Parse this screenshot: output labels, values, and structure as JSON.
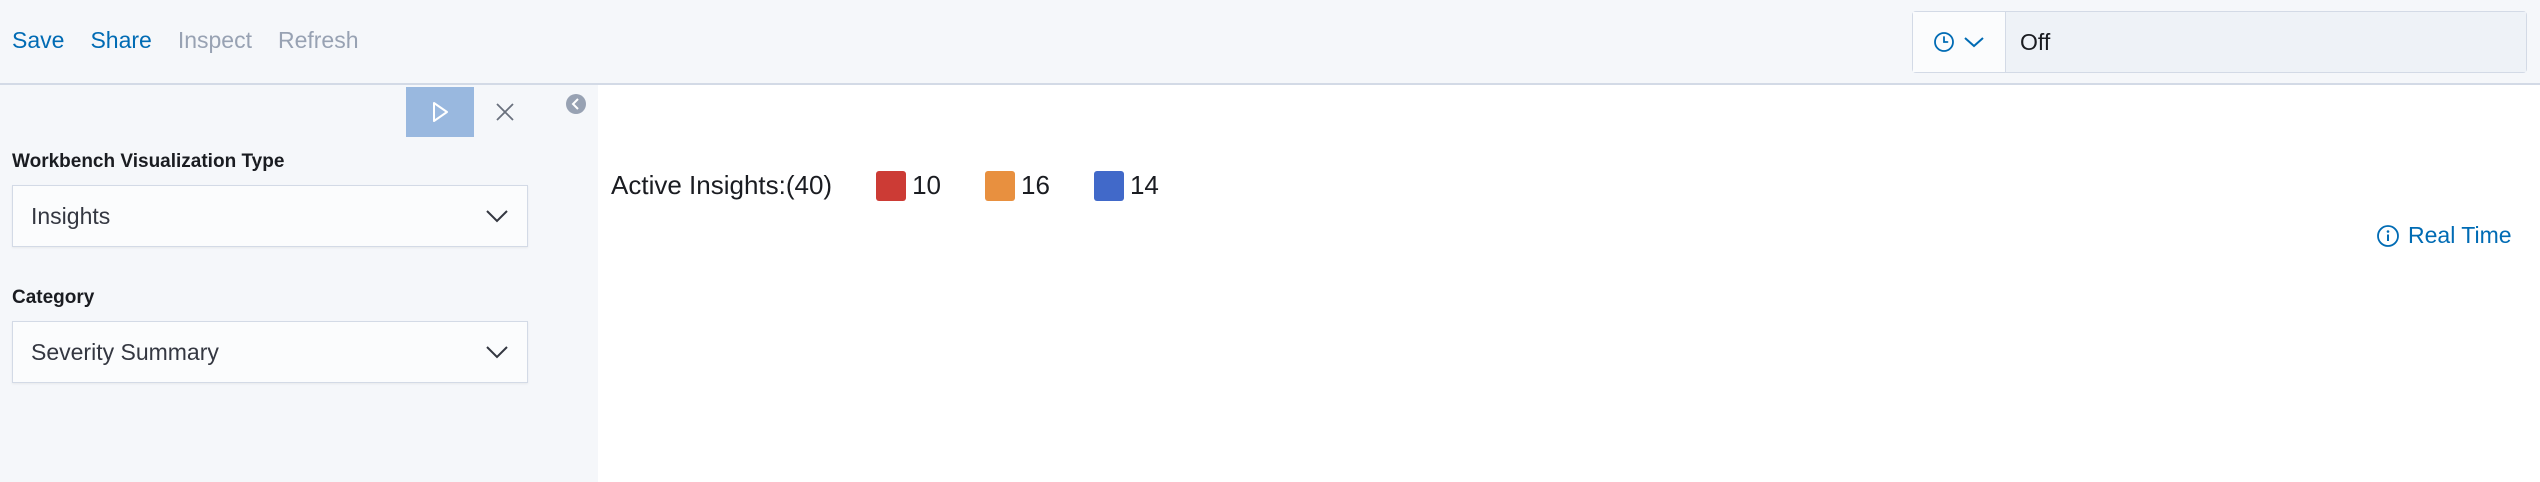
{
  "topnav": {
    "save": "Save",
    "share": "Share",
    "inspect": "Inspect",
    "refresh": "Refresh"
  },
  "auto_refresh": {
    "icon": "clock-icon",
    "value": "Off"
  },
  "sidebar": {
    "run_icon": "play-icon",
    "close_icon": "close-icon",
    "visualization_type": {
      "label": "Workbench Visualization Type",
      "value": "Insights"
    },
    "category": {
      "label": "Category",
      "value": "Severity Summary"
    },
    "collapse_icon": "chevron-left-circle-icon"
  },
  "insights": {
    "label": "Active Insights:(40)",
    "legend": [
      {
        "value": "10",
        "color": "#cc3b35"
      },
      {
        "value": "16",
        "color": "#e8903f"
      },
      {
        "value": "14",
        "color": "#4169c9"
      }
    ]
  },
  "realtime": {
    "icon": "info-icon",
    "label": "Real Time"
  },
  "colors": {
    "accent": "#006bb4",
    "muted": "#98a2b3",
    "run_button": "#99b8df"
  }
}
